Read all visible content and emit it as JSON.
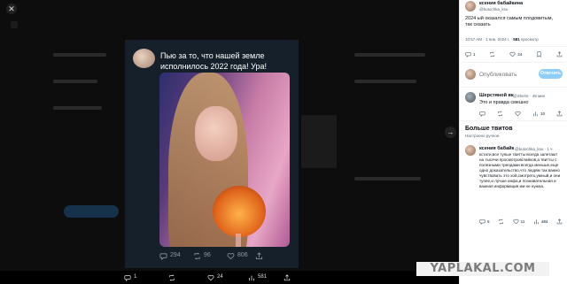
{
  "viewer": {
    "close_icon": "close-icon",
    "tweet_text": "Пью за то, что нашей земле исполнилось 2022 года! Ура!",
    "photo_stats": {
      "replies": "294",
      "retweets": "96",
      "likes": "806"
    },
    "bottom_stats": {
      "replies": "1",
      "retweets": "",
      "likes": "24",
      "views": "581"
    }
  },
  "panel": {
    "author": {
      "name": "ксения бабайкина",
      "handle": "@butochka_ksu"
    },
    "tweet_text": "2024 ый оказался самым плодовитым, так сказать",
    "meta": {
      "time": "10:57 AM · 1 янв. 2024 г. · ",
      "views_count": "581",
      "views_label": " просмотр"
    },
    "actions": {
      "replies": "1",
      "retweets": "",
      "likes": "24",
      "bookmarks": ""
    },
    "reply": {
      "placeholder": "Опубликовать",
      "button": "Ответить"
    },
    "reply_tweet": {
      "name": "Шерстяной вк",
      "handle": "@Shersr · 45 мин",
      "text": "Это и правда смешно",
      "likes": "",
      "views": "10"
    },
    "more": {
      "title": "Больше твитов",
      "subtitle": "Настроено ручное.",
      "tweet": {
        "name": "ксения бабайк",
        "handle": "@butochka_ksu · 1 ч",
        "text": "кстати,все тупые твитты всегда залетают на тысячи просмотров/лайков,а твитты с полезными трендами всегда меньше,еще одно доказательство,что людям так важно чувствовать это хой,смотреть,умный,и они тупее,и лучше инфа,и познавательная и важная информация им не нужна.",
        "replies": "5",
        "retweets": "",
        "likes": "11",
        "views": "484"
      }
    }
  },
  "watermark": "YAPLAKAL.COM",
  "colors": {
    "card_bg": "#16202b",
    "panel_bg": "#ffffff",
    "accent": "#1d9bf0",
    "reply_btn": "#8ecdf7"
  }
}
